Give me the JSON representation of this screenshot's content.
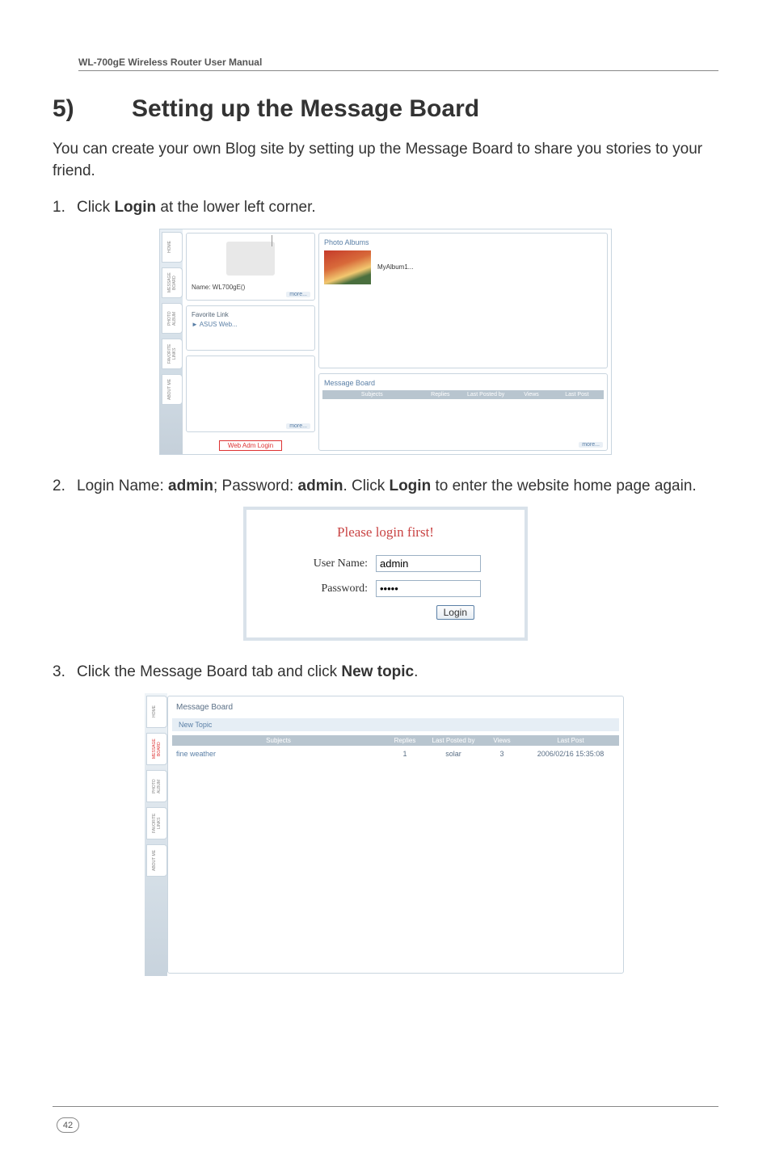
{
  "header": "WL-700gE Wireless Router User Manual",
  "title_num": "5)",
  "title_text": "Setting up the Message Board",
  "intro": "You can create your own Blog site by setting up the Message Board to share you stories to your friend.",
  "steps": {
    "s1_num": "1.",
    "s1_a": "Click ",
    "s1_b": "Login",
    "s1_c": " at the lower left corner.",
    "s2_num": "2.",
    "s2_a": "Login Name: ",
    "s2_b": "admin",
    "s2_c": "; Password: ",
    "s2_d": "admin",
    "s2_e": ". Click ",
    "s2_f": "Login",
    "s2_g": " to enter the website home page again.",
    "s3_num": "3.",
    "s3_a": "Click the Message Board tab and click ",
    "s3_b": "New topic",
    "s3_c": "."
  },
  "ss1": {
    "tabs": [
      "HOME",
      "MESSAGE BOARD",
      "PHOTO ALBUM",
      "FAVORITE LINKS",
      "ABOUT ME"
    ],
    "name_label": "Name:",
    "name_value": "WL700gE()",
    "more": "more...",
    "fav_title": "Favorite Link",
    "fav_link": "► ASUS Web...",
    "login": "Web Adm Login",
    "photo_title": "Photo Albums",
    "thumb_label": "MyAlbum1...",
    "msg_title": "Message Board",
    "msg_cols": [
      "Subjects",
      "Replies",
      "Last Posted by",
      "Views",
      "Last Post"
    ]
  },
  "ss2": {
    "title": "Please login first!",
    "user_label": "User Name:",
    "user_value": "admin",
    "pass_label": "Password:",
    "pass_value": "•••••",
    "login_btn": "Login"
  },
  "ss3": {
    "tabs": [
      "HOME",
      "MESSAGE BOARD",
      "PHOTO ALBUM",
      "FAVORITE LINKS",
      "ABOUT ME"
    ],
    "title": "Message Board",
    "new_topic": "New Topic",
    "cols": [
      "Subjects",
      "Replies",
      "Last Posted by",
      "Views",
      "Last Post"
    ],
    "row": {
      "subject": "fine weather",
      "replies": "1",
      "posted_by": "solar",
      "views": "3",
      "last_post": "2006/02/16 15:35:08"
    }
  },
  "page_num": "42"
}
